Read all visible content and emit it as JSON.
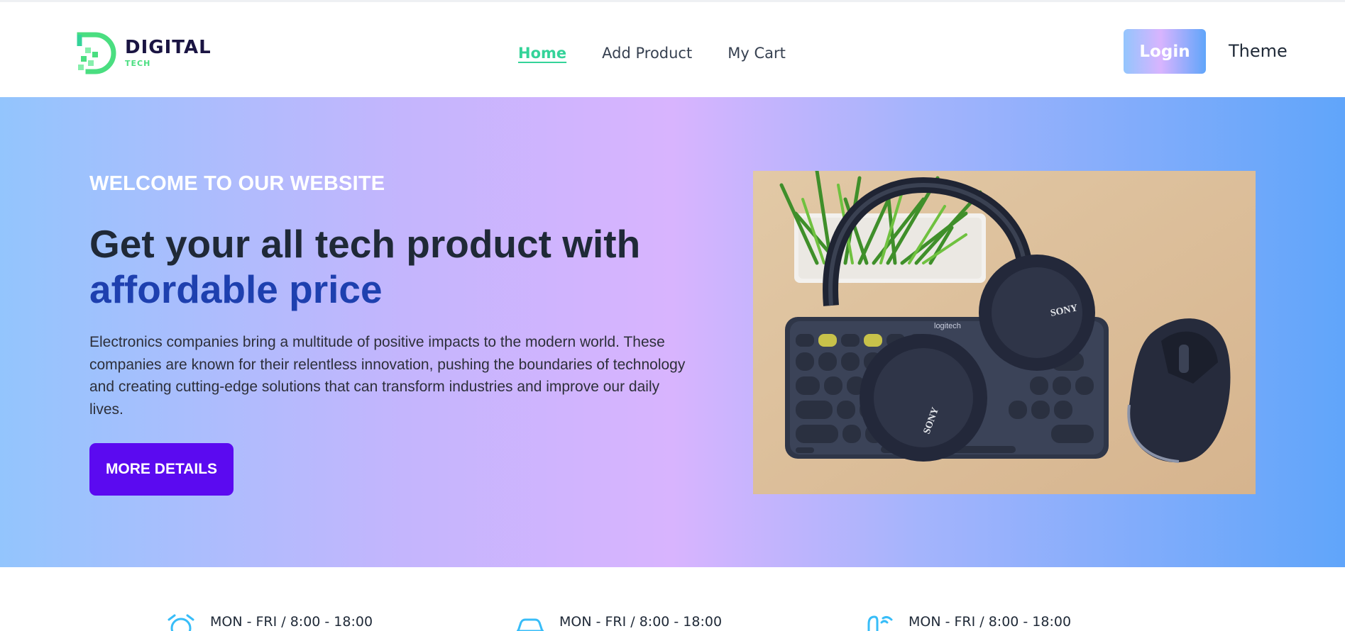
{
  "brand": {
    "name": "DIGITAL",
    "sub": "TECH",
    "colors": {
      "navy": "#1a1442",
      "green": "#4ade80"
    }
  },
  "nav": {
    "items": [
      {
        "label": "Home",
        "active": true
      },
      {
        "label": "Add Product",
        "active": false
      },
      {
        "label": "My Cart",
        "active": false
      }
    ]
  },
  "header": {
    "login_label": "Login",
    "theme_label": "Theme"
  },
  "hero": {
    "kicker": "WELCOME TO OUR WEBSITE",
    "headline_line1": "Get your all tech product with",
    "headline_accent": "affordable price",
    "description": "Electronics companies bring a multitude of positive impacts to the modern world. These companies are known for their relentless innovation, pushing the boundaries of technology and creating cutting-edge solutions that can transform industries and improve our daily lives.",
    "cta_label": "MORE DETAILS",
    "image_semantic": "headphones-keyboard-mouse-photo",
    "photo_keyboard_brand": "logitech",
    "photo_headphone_brand": "SONY",
    "colors": {
      "accent": "#1e40af",
      "cta": "#5b0af0"
    }
  },
  "info": {
    "items": [
      {
        "icon": "alarm-clock-icon",
        "text": "MON - FRI / 8:00 - 18:00"
      },
      {
        "icon": "car-icon",
        "text": "MON - FRI / 8:00 - 18:00"
      },
      {
        "icon": "headset-icon",
        "text": "MON - FRI / 8:00 - 18:00"
      }
    ],
    "icon_color": "#38bdf8"
  }
}
